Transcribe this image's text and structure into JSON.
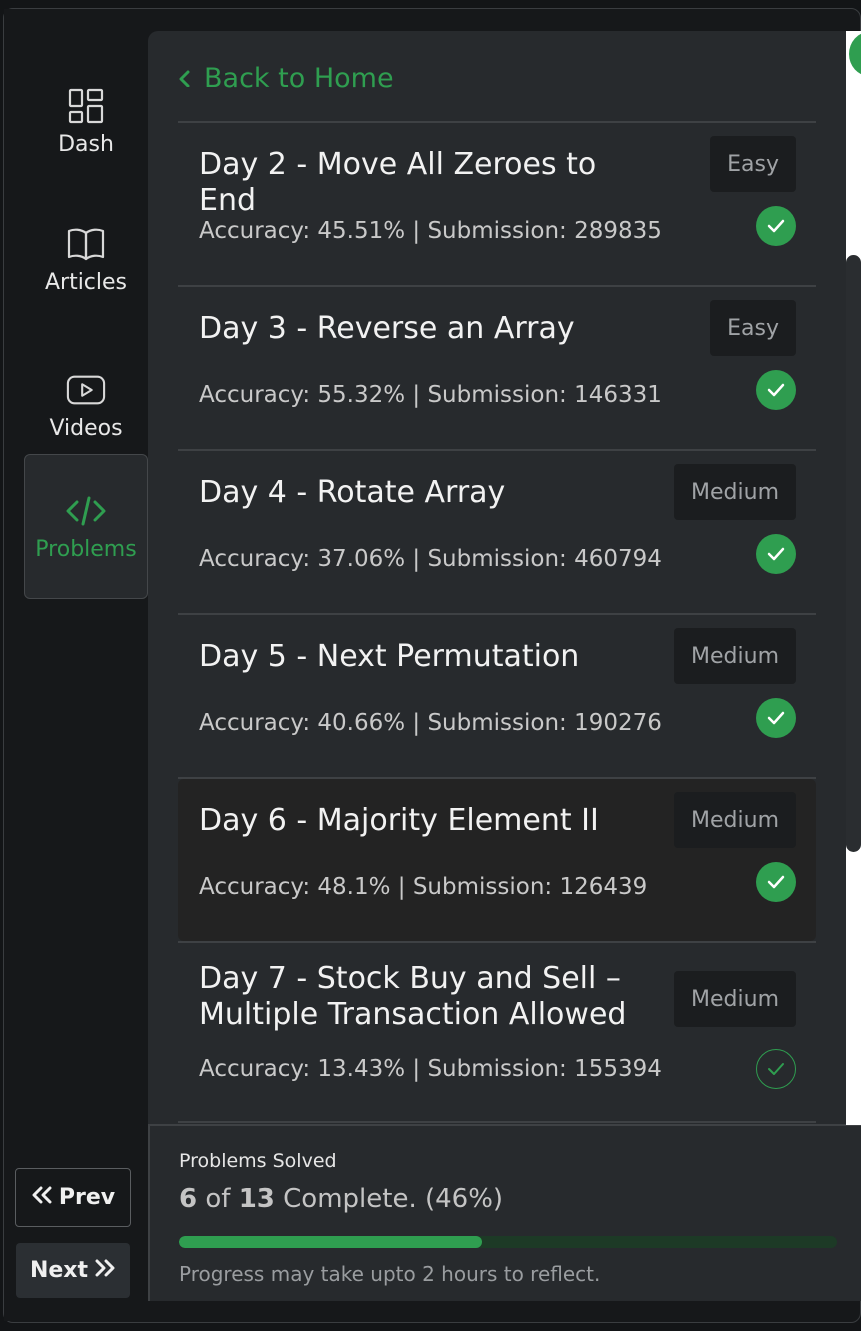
{
  "sidebar": {
    "items": [
      {
        "label": "Dash",
        "icon": "dashboard-icon"
      },
      {
        "label": "Articles",
        "icon": "book-icon"
      },
      {
        "label": "Videos",
        "icon": "play-icon"
      },
      {
        "label": "Problems",
        "icon": "code-icon",
        "active": true
      }
    ],
    "prev_label": "Prev",
    "next_label": "Next"
  },
  "main": {
    "back_label": "Back to Home",
    "problems": [
      {
        "title": "Day 2 - Move All Zeroes to End",
        "difficulty": "Easy",
        "stats": "Accuracy: 45.51% | Submission: 289835",
        "solved": true
      },
      {
        "title": "Day 3 - Reverse an Array",
        "difficulty": "Easy",
        "stats": "Accuracy: 55.32% | Submission: 146331",
        "solved": true
      },
      {
        "title": "Day 4 - Rotate Array",
        "difficulty": "Medium",
        "stats": "Accuracy: 37.06% | Submission: 460794",
        "solved": true
      },
      {
        "title": "Day 5 - Next Permutation",
        "difficulty": "Medium",
        "stats": "Accuracy: 40.66% | Submission: 190276",
        "solved": true
      },
      {
        "title": "Day 6 - Majority Element II",
        "difficulty": "Medium",
        "stats": "Accuracy: 48.1% | Submission: 126439",
        "solved": true
      },
      {
        "title": "Day 7 - Stock Buy and Sell – Multiple Transaction Allowed",
        "difficulty": "Medium",
        "stats": "Accuracy: 13.43% | Submission: 155394",
        "solved": false
      }
    ]
  },
  "progress": {
    "label": "Problems Solved",
    "solved": "6",
    "of_word": "of",
    "total": "13",
    "suffix": "Complete. (46%)",
    "fraction": 0.46,
    "note": "Progress may take upto 2 hours to reflect."
  },
  "colors": {
    "accent": "#2f9e50",
    "panel": "#272a2d",
    "background": "#16181a"
  }
}
